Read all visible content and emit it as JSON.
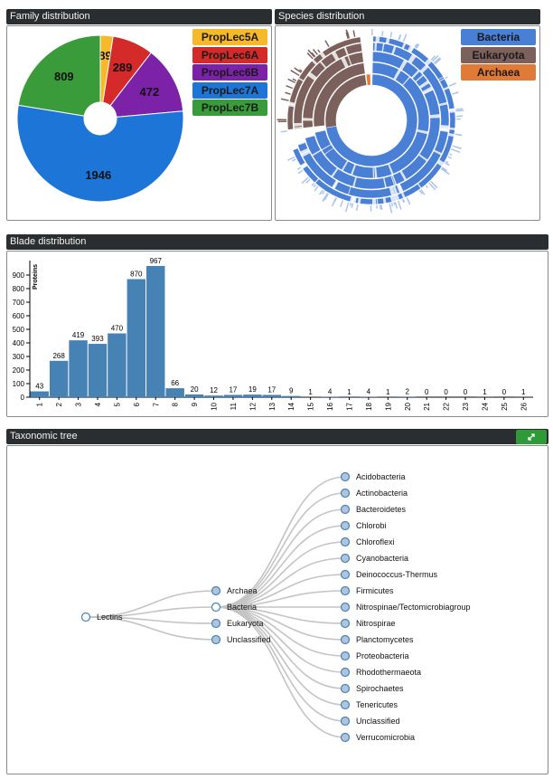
{
  "panels": {
    "family_title": "Family distribution",
    "species_title": "Species distribution",
    "blade_title": "Blade distribution",
    "tree_title": "Taxonomic tree",
    "expand_icon": "expand-arrows-icon"
  },
  "family_legend": [
    {
      "label": "PropLec5A",
      "color": "#f5b92a"
    },
    {
      "label": "PropLec6A",
      "color": "#d42a2a"
    },
    {
      "label": "PropLec6B",
      "color": "#7b22a8"
    },
    {
      "label": "PropLec7A",
      "color": "#1d75d8"
    },
    {
      "label": "PropLec7B",
      "color": "#3a9b3a"
    }
  ],
  "species_legend": [
    {
      "label": "Bacteria",
      "color": "#4a7fd6"
    },
    {
      "label": "Eukaryota",
      "color": "#7c605c"
    },
    {
      "label": "Archaea",
      "color": "#e07a36"
    }
  ],
  "chart_data": [
    {
      "type": "pie",
      "name": "Family distribution",
      "labels": [
        "PropLec5A",
        "PropLec6A",
        "PropLec6B",
        "PropLec7A",
        "PropLec7B"
      ],
      "values": [
        89,
        289,
        472,
        1946,
        809
      ],
      "colors": [
        "#f5b92a",
        "#d42a2a",
        "#7b22a8",
        "#1d75d8",
        "#3a9b3a"
      ],
      "donut_hole": true
    },
    {
      "type": "pie",
      "name": "Species distribution",
      "labels": [
        "Bacteria",
        "Eukaryota",
        "Archaea"
      ],
      "colors": [
        "#4a7fd6",
        "#7c605c",
        "#e07a36"
      ],
      "style": "sunburst"
    },
    {
      "type": "bar",
      "name": "Blade distribution",
      "categories": [
        "1",
        "2",
        "3",
        "4",
        "5",
        "6",
        "7",
        "8",
        "9",
        "10",
        "11",
        "12",
        "13",
        "14",
        "15",
        "16",
        "17",
        "18",
        "19",
        "20",
        "21",
        "22",
        "23",
        "24",
        "25",
        "26"
      ],
      "values": [
        43,
        268,
        419,
        393,
        470,
        870,
        967,
        66,
        20,
        12,
        17,
        19,
        17,
        9,
        1,
        4,
        1,
        4,
        1,
        2,
        0,
        0,
        0,
        1,
        0,
        1
      ],
      "ylabel": "Proteins",
      "yticks": [
        0,
        100,
        200,
        300,
        400,
        500,
        600,
        700,
        800,
        900
      ],
      "ylim": [
        0,
        980
      ],
      "color": "#4682b4"
    }
  ],
  "tree": {
    "root": "Lectins",
    "level1": [
      "Archaea",
      "Bacteria",
      "Eukaryota",
      "Unclassified"
    ],
    "bacteria_children": [
      "Acidobacteria",
      "Actinobacteria",
      "Bacteroidetes",
      "Chlorobi",
      "Chloroflexi",
      "Cyanobacteria",
      "Deinococcus-Thermus",
      "Firmicutes",
      "Nitrospinae/Tectomicrobiagroup",
      "Nitrospirae",
      "Planctomycetes",
      "Proteobacteria",
      "Rhodothermaeota",
      "Spirochaetes",
      "Tenericutes",
      "Unclassified",
      "Verrucomicrobia"
    ]
  }
}
